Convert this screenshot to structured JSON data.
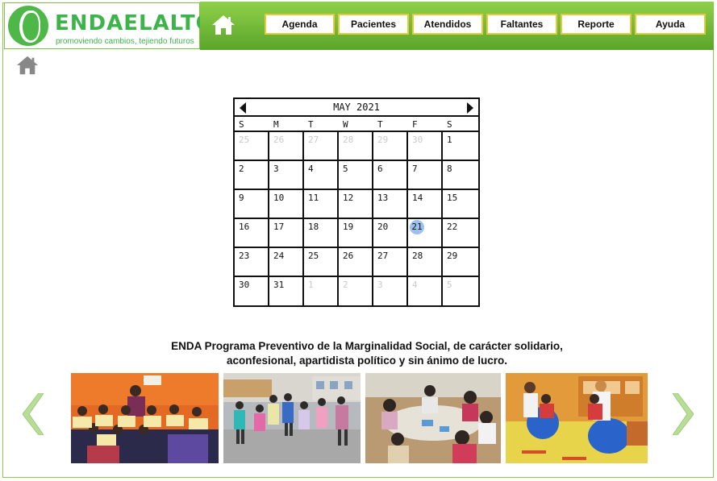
{
  "brand": {
    "name": "ENDAELALTO",
    "tagline": "promoviendo cambios, tejiendo futuros",
    "color_green": "#3cb44a",
    "header_gradient": [
      "#8fd04a",
      "#5aa52a"
    ],
    "button_border": "#e9c93a"
  },
  "nav": {
    "home_icon": "home-icon",
    "items": [
      {
        "label": "Agenda"
      },
      {
        "label": "Pacientes"
      },
      {
        "label": "Atendidos"
      },
      {
        "label": "Faltantes"
      },
      {
        "label": "Reporte"
      },
      {
        "label": "Ayuda"
      }
    ]
  },
  "secondary_home_icon": "home-icon",
  "calendar": {
    "title": "MAY 2021",
    "prev_icon": "triangle-left-icon",
    "next_icon": "triangle-right-icon",
    "weekdays": [
      "S",
      "M",
      "T",
      "W",
      "T",
      "F",
      "S"
    ],
    "weeks": [
      [
        {
          "d": "25",
          "m": true
        },
        {
          "d": "26",
          "m": true
        },
        {
          "d": "27",
          "m": true
        },
        {
          "d": "28",
          "m": true
        },
        {
          "d": "29",
          "m": true
        },
        {
          "d": "30",
          "m": true
        },
        {
          "d": "1"
        }
      ],
      [
        {
          "d": "2"
        },
        {
          "d": "3"
        },
        {
          "d": "4"
        },
        {
          "d": "5"
        },
        {
          "d": "6"
        },
        {
          "d": "7"
        },
        {
          "d": "8"
        }
      ],
      [
        {
          "d": "9"
        },
        {
          "d": "10"
        },
        {
          "d": "11"
        },
        {
          "d": "12"
        },
        {
          "d": "13"
        },
        {
          "d": "14"
        },
        {
          "d": "15"
        }
      ],
      [
        {
          "d": "16"
        },
        {
          "d": "17"
        },
        {
          "d": "18"
        },
        {
          "d": "19"
        },
        {
          "d": "20"
        },
        {
          "d": "21",
          "today": true
        },
        {
          "d": "22"
        }
      ],
      [
        {
          "d": "23"
        },
        {
          "d": "24"
        },
        {
          "d": "25"
        },
        {
          "d": "26"
        },
        {
          "d": "27"
        },
        {
          "d": "28"
        },
        {
          "d": "29"
        }
      ],
      [
        {
          "d": "30"
        },
        {
          "d": "31"
        },
        {
          "d": "1",
          "m": true
        },
        {
          "d": "2",
          "m": true
        },
        {
          "d": "3",
          "m": true
        },
        {
          "d": "4",
          "m": true
        },
        {
          "d": "5",
          "m": true
        }
      ]
    ],
    "today_color": "#9cc1ee"
  },
  "description": {
    "line1": "ENDA Programa Preventivo de la Marginalidad Social, de carácter solidario,",
    "line2": "aconfesional, apartidista político y sin ánimo de lucro."
  },
  "carousel": {
    "prev_icon": "chevron-left-icon",
    "next_icon": "chevron-right-icon",
    "chevron_color": "#b8dd96",
    "photos": [
      {
        "name": "photo-children-holding-papers"
      },
      {
        "name": "photo-children-jumping"
      },
      {
        "name": "photo-children-drawing"
      },
      {
        "name": "photo-therapy-balls"
      }
    ]
  }
}
